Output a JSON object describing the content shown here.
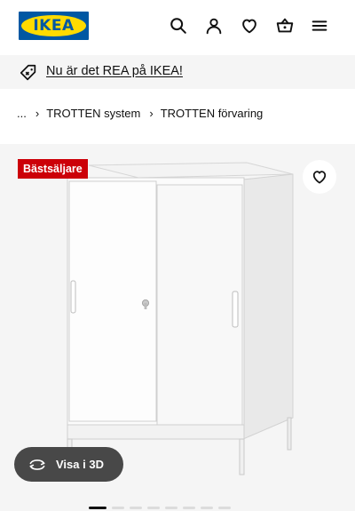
{
  "header": {
    "logo_text": "IKEA",
    "icons": [
      "search-icon",
      "account-icon",
      "favourites-icon",
      "cart-icon",
      "menu-icon"
    ]
  },
  "promo": {
    "text": "Nu är det REA på IKEA!",
    "icon": "price-tag-icon"
  },
  "breadcrumb": {
    "ellipsis": "...",
    "items": [
      "TROTTEN system",
      "TROTTEN förvaring"
    ]
  },
  "product": {
    "badge": "Bästsäljare",
    "view_3d_label": "Visa i 3D",
    "image_count": 8,
    "active_image": 1
  },
  "colors": {
    "brand_blue": "#0058a3",
    "brand_yellow": "#ffdb00",
    "badge_red": "#cc0008",
    "gallery_bg": "#f5f5f5",
    "pill_bg": "#484848"
  }
}
